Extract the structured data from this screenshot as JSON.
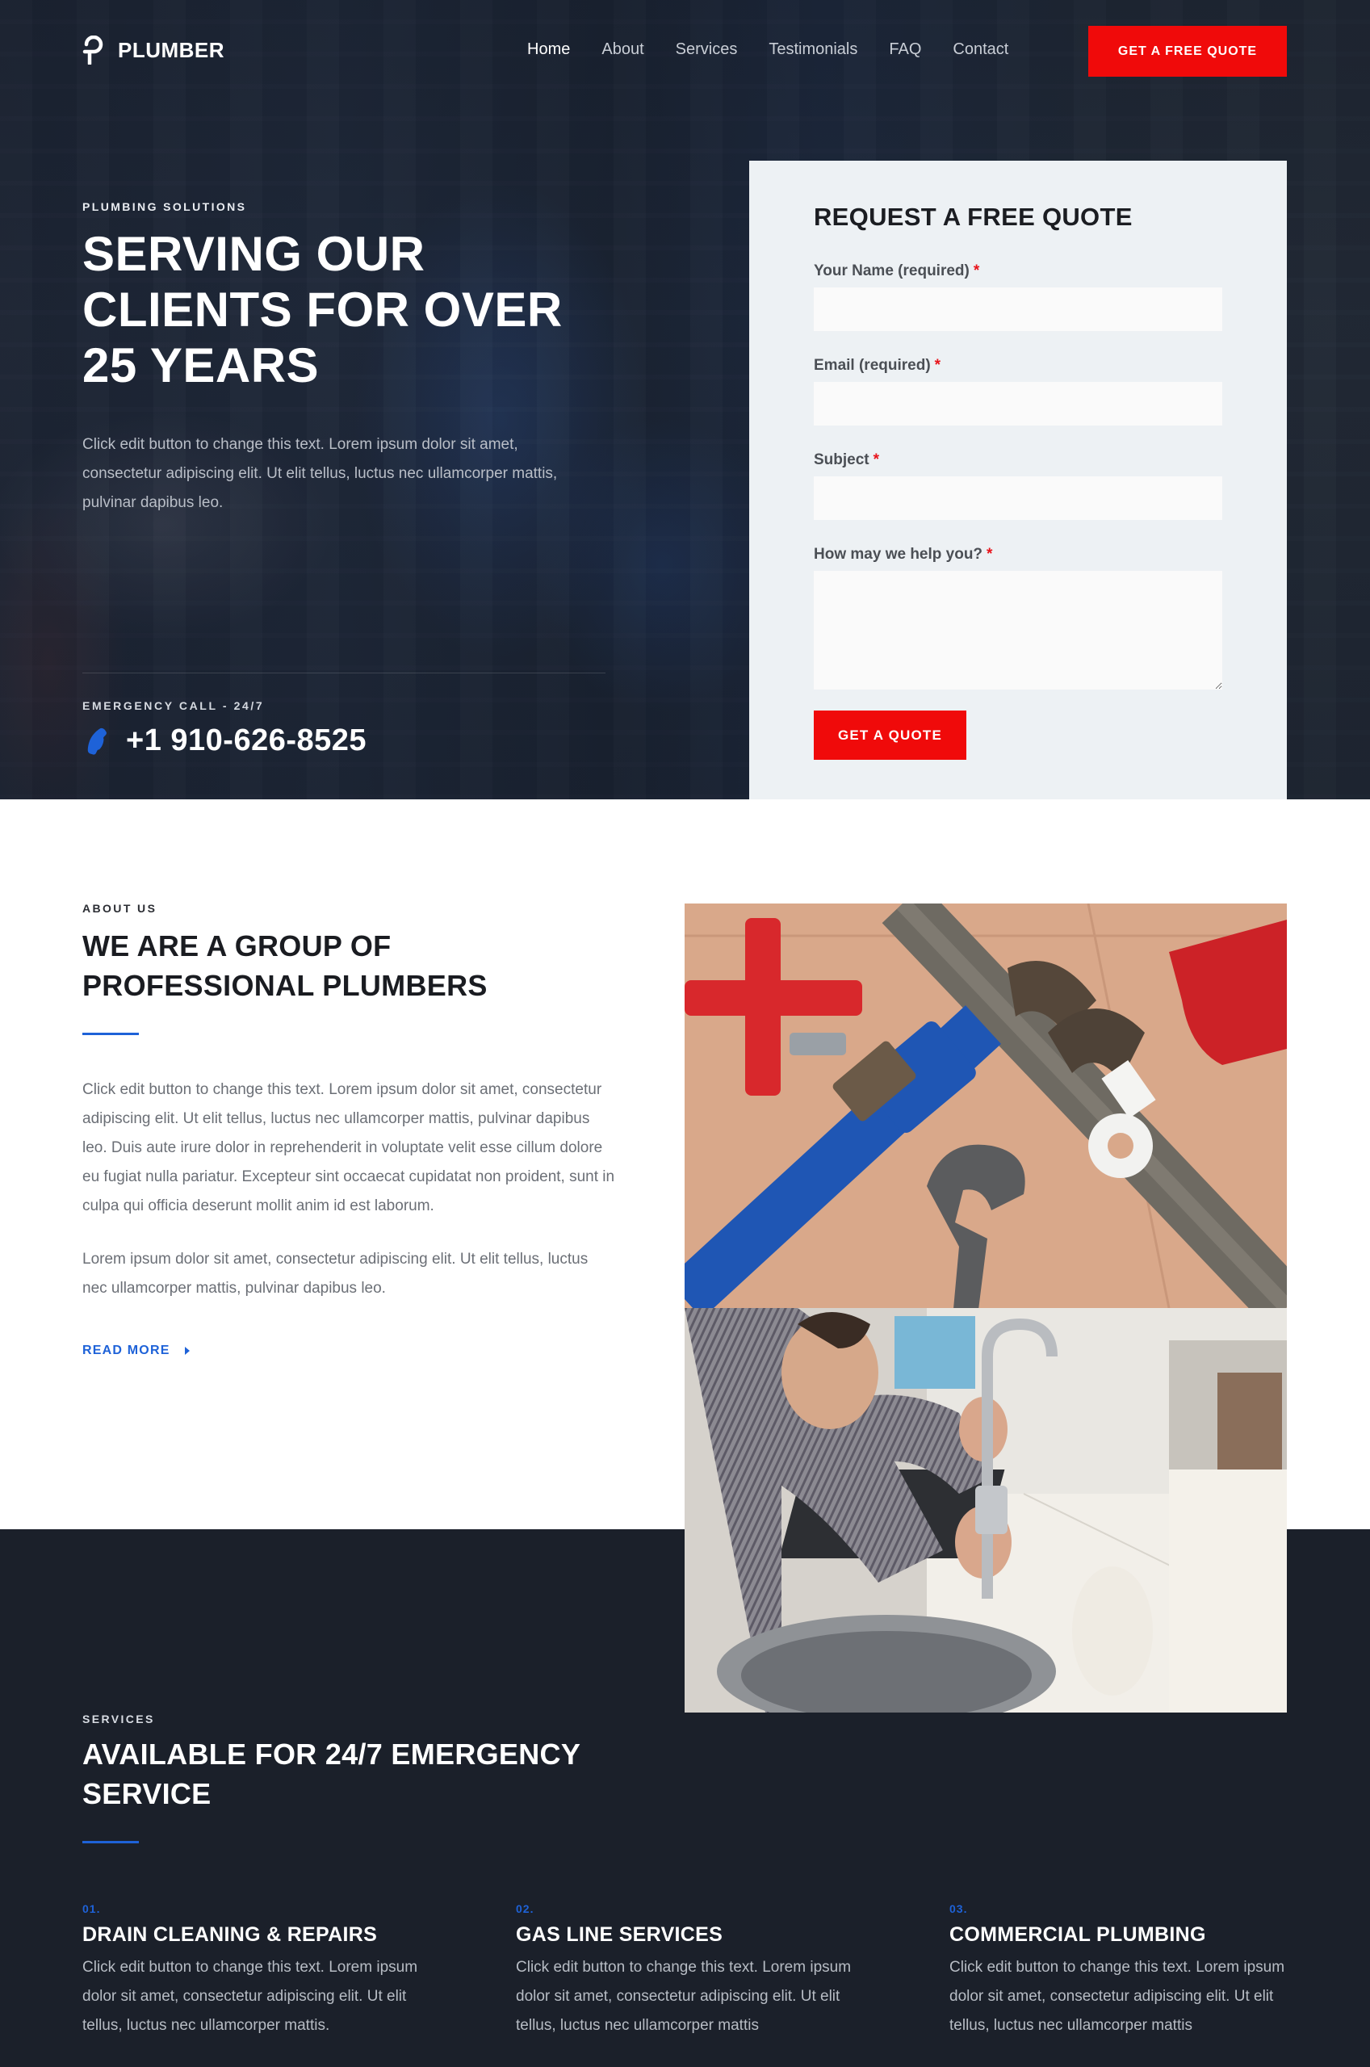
{
  "brand": {
    "name": "PLUMBER",
    "logo_icon": "p-letter-logo-icon",
    "accent_red": "#f00a0a",
    "accent_blue": "#1e62d8",
    "dark_bg": "#1b202a"
  },
  "nav": {
    "links": [
      {
        "label": "Home",
        "active": true
      },
      {
        "label": "About",
        "active": false
      },
      {
        "label": "Services",
        "active": false
      },
      {
        "label": "Testimonials",
        "active": false
      },
      {
        "label": "FAQ",
        "active": false
      },
      {
        "label": "Contact",
        "active": false
      }
    ],
    "cta_label": "GET A FREE QUOTE"
  },
  "hero": {
    "eyebrow": "PLUMBING SOLUTIONS",
    "title": "SERVING OUR CLIENTS FOR OVER 25 YEARS",
    "description": "Click edit button to change this text. Lorem ipsum dolor sit amet, consectetur adipiscing elit. Ut elit tellus, luctus nec ullamcorper mattis, pulvinar dapibus leo.",
    "emergency_label": "EMERGENCY CALL - 24/7",
    "phone_icon": "phone-icon",
    "phone": "+1 910-626-8525"
  },
  "quote_form": {
    "title": "REQUEST A FREE QUOTE",
    "required_marker": "*",
    "fields": [
      {
        "label": "Your Name (required)",
        "value": "",
        "placeholder": ""
      },
      {
        "label": "Email (required)",
        "value": "",
        "placeholder": ""
      },
      {
        "label": "Subject",
        "value": "",
        "placeholder": ""
      },
      {
        "label": "How may we help you?",
        "value": "",
        "placeholder": ""
      }
    ],
    "submit_label": "GET A QUOTE"
  },
  "about": {
    "eyebrow": "ABOUT US",
    "title": "WE ARE A GROUP OF PROFESSIONAL PLUMBERS",
    "paragraph_1": "Click edit button to change this text. Lorem ipsum dolor sit amet, consectetur adipiscing elit. Ut elit tellus, luctus nec ullamcorper mattis, pulvinar dapibus leo. Duis aute irure dolor in reprehenderit in voluptate velit esse cillum dolore eu fugiat nulla pariatur. Excepteur sint occaecat cupidatat non proident, sunt in culpa qui officia deserunt mollit anim id est laborum.",
    "paragraph_2": "Lorem ipsum dolor sit amet, consectetur adipiscing elit. Ut elit tellus, luctus nec ullamcorper mattis, pulvinar dapibus leo.",
    "read_more_label": "READ MORE",
    "images": [
      {
        "alt": "Plumbing wrenches and pipe tools"
      },
      {
        "alt": "Plumber repairing kitchen faucet"
      }
    ]
  },
  "services": {
    "eyebrow": "SERVICES",
    "title": "AVAILABLE FOR 24/7 EMERGENCY SERVICE",
    "items": [
      {
        "number": "01.",
        "title": "DRAIN CLEANING & REPAIRS",
        "description": "Click edit button to change this text. Lorem ipsum dolor sit amet, consectetur adipiscing elit. Ut elit tellus, luctus nec ullamcorper mattis."
      },
      {
        "number": "02.",
        "title": "GAS LINE SERVICES",
        "description": "Click edit button to change this text. Lorem ipsum dolor sit amet, consectetur adipiscing elit. Ut elit tellus, luctus nec ullamcorper mattis"
      },
      {
        "number": "03.",
        "title": "COMMERCIAL PLUMBING",
        "description": "Click edit button to change this text. Lorem ipsum dolor sit amet, consectetur adipiscing elit. Ut elit tellus, luctus nec ullamcorper mattis"
      }
    ]
  }
}
